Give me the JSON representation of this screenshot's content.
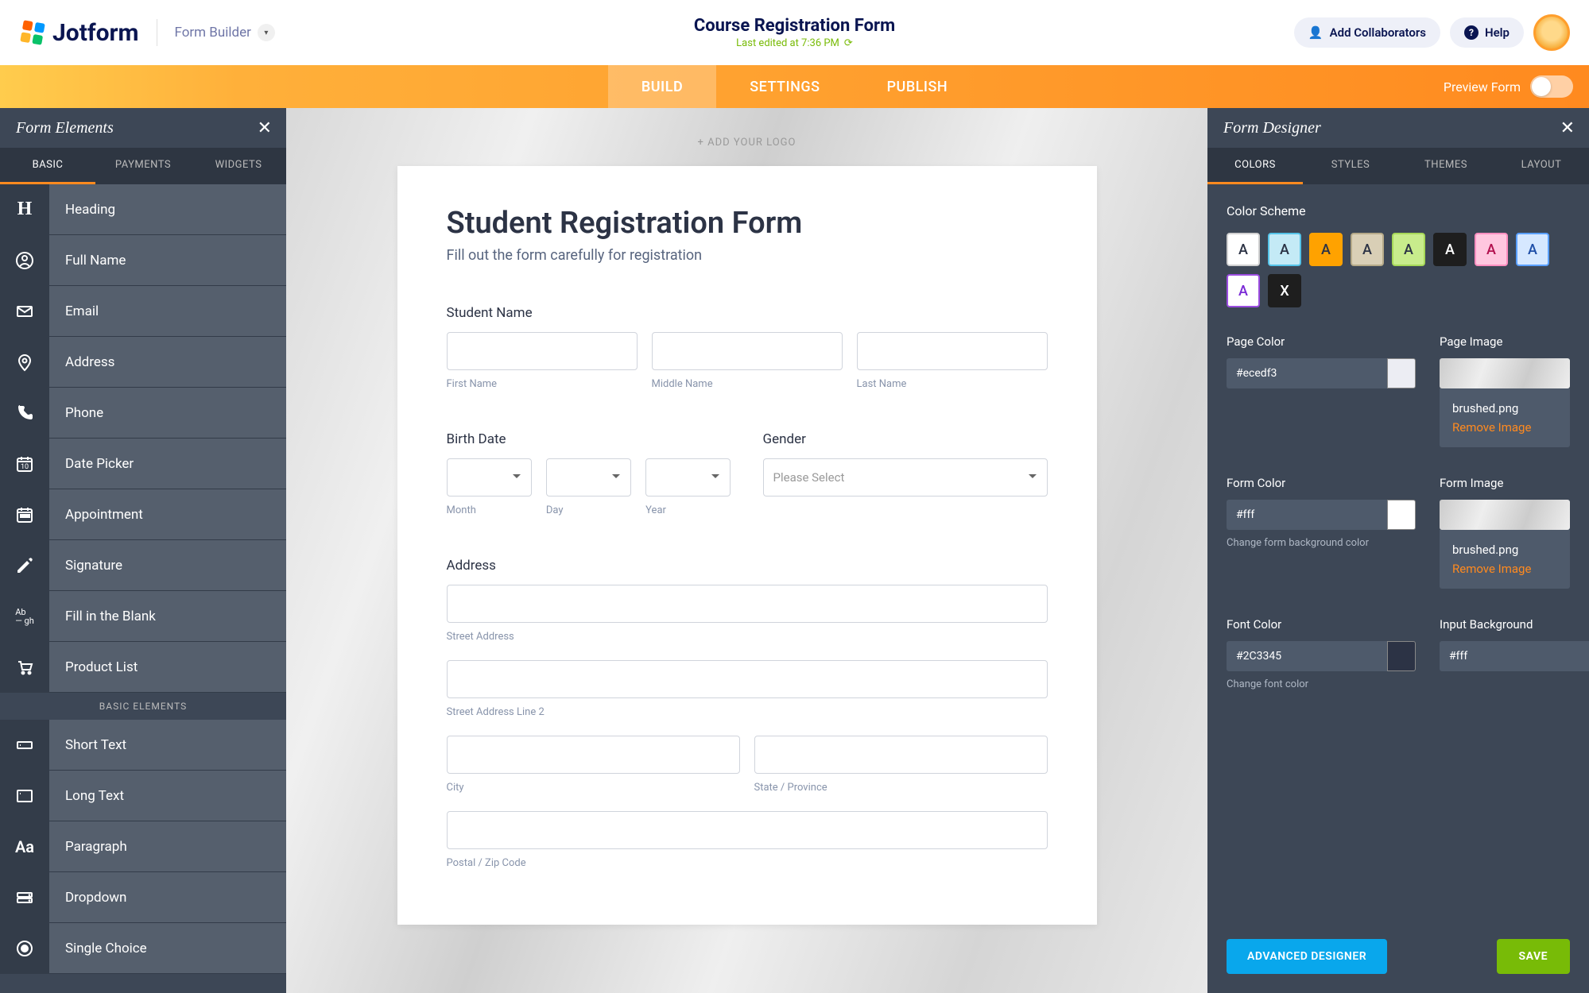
{
  "header": {
    "brand": "Jotform",
    "form_builder": "Form Builder",
    "title": "Course Registration Form",
    "last_edit": "Last edited at 7:36 PM",
    "collab": "Add Collaborators",
    "help": "Help"
  },
  "tabs": {
    "build": "BUILD",
    "settings": "SETTINGS",
    "publish": "PUBLISH",
    "preview": "Preview Form"
  },
  "left": {
    "title": "Form Elements",
    "tabs": {
      "basic": "BASIC",
      "payments": "PAYMENTS",
      "widgets": "WIDGETS"
    },
    "section_hdr": "BASIC ELEMENTS",
    "items": [
      {
        "label": "Heading",
        "icon": "H"
      },
      {
        "label": "Full Name",
        "icon": "user"
      },
      {
        "label": "Email",
        "icon": "mail"
      },
      {
        "label": "Address",
        "icon": "pin"
      },
      {
        "label": "Phone",
        "icon": "phone"
      },
      {
        "label": "Date Picker",
        "icon": "date"
      },
      {
        "label": "Appointment",
        "icon": "cal"
      },
      {
        "label": "Signature",
        "icon": "sig"
      },
      {
        "label": "Fill in the Blank",
        "icon": "blank"
      },
      {
        "label": "Product List",
        "icon": "cart"
      }
    ],
    "items2": [
      {
        "label": "Short Text",
        "icon": "short"
      },
      {
        "label": "Long Text",
        "icon": "long"
      },
      {
        "label": "Paragraph",
        "icon": "Aa"
      },
      {
        "label": "Dropdown",
        "icon": "dd"
      },
      {
        "label": "Single Choice",
        "icon": "radio"
      }
    ]
  },
  "form": {
    "add_logo": "+ ADD YOUR LOGO",
    "h1": "Student Registration Form",
    "sub": "Fill out the form carefully for registration",
    "student_name": "Student Name",
    "first_name": "First Name",
    "middle_name": "Middle Name",
    "last_name": "Last Name",
    "birth_date": "Birth Date",
    "month": "Month",
    "day": "Day",
    "year": "Year",
    "gender": "Gender",
    "please_select": "Please Select",
    "address": "Address",
    "street": "Street Address",
    "street2": "Street Address Line 2",
    "city": "City",
    "state": "State / Province",
    "postal": "Postal / Zip Code"
  },
  "right": {
    "title": "Form Designer",
    "tabs": {
      "colors": "COLORS",
      "styles": "STYLES",
      "themes": "THEMES",
      "layout": "LAYOUT"
    },
    "color_scheme": "Color Scheme",
    "swatches": [
      {
        "bg": "#ffffff",
        "fg": "#2c3345",
        "border": "#d0d0d0"
      },
      {
        "bg": "#c4eaf6",
        "fg": "#2c3345",
        "border": "#55c3e8"
      },
      {
        "bg": "#ffa200",
        "fg": "#2c3345",
        "border": "#ffa200"
      },
      {
        "bg": "#d9cfb6",
        "fg": "#2c3345",
        "border": "#b5a988"
      },
      {
        "bg": "#c8ec8c",
        "fg": "#2c3345",
        "border": "#a6d858"
      },
      {
        "bg": "#1e1e1e",
        "fg": "#ffffff",
        "border": "#1e1e1e"
      },
      {
        "bg": "#ffc7df",
        "fg": "#b3124f",
        "border": "#ff8fc0"
      },
      {
        "bg": "#d6e8ff",
        "fg": "#1f4fa8",
        "border": "#5aa0ff"
      },
      {
        "bg": "#ffffff",
        "fg": "#7b2bd6",
        "border": "#9b4de0"
      },
      {
        "bg": "#1e1e1e",
        "fg": "#ffffff",
        "border": "#1e1e1e",
        "text": "X"
      }
    ],
    "page_color_lbl": "Page Color",
    "page_color": "#ecedf3",
    "page_image_lbl": "Page Image",
    "page_image_name": "brushed.png",
    "remove_image": "Remove Image",
    "form_color_lbl": "Form Color",
    "form_color": "#fff",
    "form_color_hint": "Change form background color",
    "form_image_lbl": "Form Image",
    "form_image_name": "brushed.png",
    "font_color_lbl": "Font Color",
    "font_color": "#2C3345",
    "font_color_hint": "Change font color",
    "input_bg_lbl": "Input Background",
    "input_bg": "#fff",
    "adv": "ADVANCED DESIGNER",
    "save": "SAVE"
  }
}
